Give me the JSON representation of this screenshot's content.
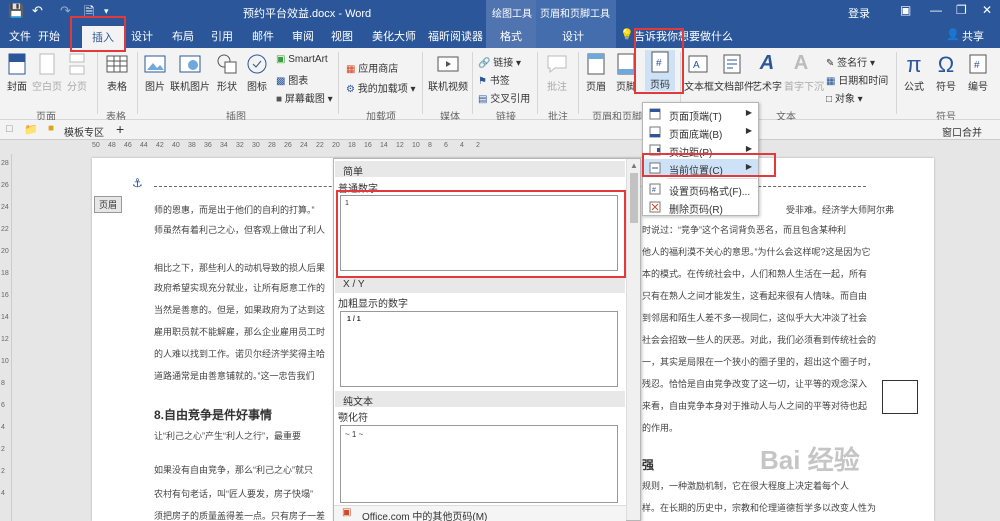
{
  "titlebar": {
    "title": "预约平台效益.docx - Word",
    "ctx_draw": "绘图工具",
    "ctx_header": "页眉和页脚工具",
    "login": "登录"
  },
  "tabs": [
    "文件",
    "开始",
    "插入",
    "设计",
    "布局",
    "引用",
    "邮件",
    "审阅",
    "视图",
    "美化大师",
    "福昕阅读器",
    "格式",
    "设计"
  ],
  "tellme": "告诉我你想要做什么",
  "share": "共享",
  "ribbon": {
    "cover": "封面",
    "blank": "空白页",
    "pagebreak": "分页",
    "g_pages": "页面",
    "table": "表格",
    "g_table": "表格",
    "picture": "图片",
    "online_pic": "联机图片",
    "shapes": "形状",
    "icons": "图标",
    "smartart": "SmartArt",
    "chart": "图表",
    "screenshot": "屏幕截图",
    "g_illus": "插图",
    "store": "应用商店",
    "myaddins": "我的加载项",
    "g_addins": "加载项",
    "video": "联机视频",
    "g_media": "媒体",
    "link": "链接",
    "bookmark": "书签",
    "crossref": "交叉引用",
    "g_links": "链接",
    "comment": "批注",
    "g_comment": "批注",
    "header": "页眉",
    "footer": "页脚",
    "pagenum": "页码",
    "g_hf": "页眉和页脚",
    "textbox": "文本框",
    "quickparts": "文档部件",
    "wordart": "艺术字",
    "dropcap": "首字下沉",
    "sigline": "签名行",
    "datetime": "日期和时间",
    "object": "对象",
    "g_text": "文本",
    "equation": "公式",
    "symbol": "符号",
    "number": "编号",
    "g_symbol": "符号"
  },
  "doctabs": {
    "template": "模板专区",
    "add": "+",
    "right": "窗口合并"
  },
  "ruler_numbers": [
    "50",
    "48",
    "46",
    "44",
    "42",
    "40",
    "38",
    "36",
    "34",
    "32",
    "30",
    "28",
    "26",
    "24",
    "22",
    "20",
    "18",
    "16",
    "14",
    "12",
    "10",
    "8",
    "6",
    "4",
    "2"
  ],
  "vruler_numbers": [
    "28",
    "26",
    "24",
    "22",
    "20",
    "18",
    "16",
    "14",
    "12",
    "10",
    "8",
    "6",
    "4",
    "2",
    "2",
    "4"
  ],
  "doc": {
    "header_tag": "页眉",
    "lines_left": [
      "师的恩惠，而是出于他们的自利的打算。”",
      "师虽然有着利己之心，但客观上做出了利人",
      "相比之下，那些利人的动机导致的损人后果",
      "政府希望实现充分就业，让所有愿意工作的",
      "当然是善意的。但是，如果政府为了达到这",
      "雇用职员就不能解雇，那么企业雇用员工时",
      "的人难以找到工作。诺贝尔经济学奖得主哈",
      "道路通常是由善意铺就的。”这一忠告我们"
    ],
    "heading": "8.自由竞争是件好事情",
    "lines_left2": [
      "让“利己之心”产生“利人之行”，最重要",
      "如果没有自由竞争，那么“利己之心”就只",
      "农村有句老话，叫“匠人要发，房子快塌”",
      "须把房子的质量盖得差一点。只有房子一差"
    ],
    "lines_right": [
      "受非难。经济学大师阿尔弗",
      "时说过：“竞争”这个名词背负恶名，而且包含某种利",
      "他人的福利漠不关心的意思。”为什么会这样呢?这是因为它",
      "本的模式。在传统社会中，人们和熟人生活在一起，所有",
      "只有在熟人之间才能发生，这看起来很有人情味。而自由",
      "到邻居和陌生人差不多一视同仁，这似乎大大冲淡了社会",
      "社会会招致一些人的厌恶。对此，我们必须看到传统社会的",
      "一，其实是局限在一个狭小的圈子里的，超出这个圈子时，",
      "残忍。恰恰是自由竞争改变了这一切，让平等的观念深入",
      "来看，自由竞争本身对于推动人与人之间的平等对待也起",
      "的作用。"
    ],
    "lines_right2": [
      "强",
      "规则，一种激励机制，它在很大程度上决定着每个人",
      "样。在长期的历史中，宗教和伦理道德哲学多以改变人性为"
    ]
  },
  "gallery": {
    "section1": "简单",
    "label1": "普通数字",
    "preview1": "1",
    "section2": "X / Y",
    "label2": "加粗显示的数字",
    "preview2": "1 / 1",
    "section3": "纯文本",
    "label3": "颚化符",
    "preview3": "~ 1 ~",
    "footer": "Office.com 中的其他页码(M)"
  },
  "menu": {
    "items": [
      {
        "label": "页面顶端(T)"
      },
      {
        "label": "页面底端(B)"
      },
      {
        "label": "页边距(P)"
      },
      {
        "label": "当前位置(C)"
      },
      {
        "label": "设置页码格式(F)..."
      },
      {
        "label": "删除页码(R)"
      }
    ]
  },
  "watermark": "Bai 经验",
  "colors": {
    "accent": "#2b579a",
    "highlight": "#e23a3a",
    "hover": "#cde2f7"
  }
}
